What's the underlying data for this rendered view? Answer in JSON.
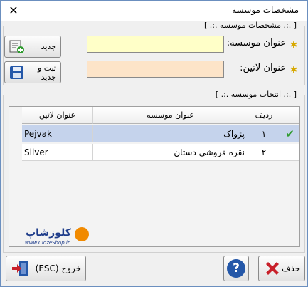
{
  "window": {
    "title": "مشخصات موسسه",
    "close_glyph": "✕"
  },
  "form_group": {
    "caption": "[ .:. مشخصات موسسه .:. ]",
    "fields": [
      {
        "label": "عنوان موسسه:",
        "value": "",
        "bg": "#ffffc8"
      },
      {
        "label": "عنوان لاتین:",
        "value": "",
        "bg": "#fde4c8"
      }
    ],
    "new_button": "جدید",
    "save_new_button": "ثبت و جدید"
  },
  "select_group": {
    "caption": "[ .:. انتخاب موسسه .:. ]",
    "columns": {
      "row": "ردیف",
      "title": "عنوان موسسه",
      "latin": "عنوان لاتین"
    },
    "rows": [
      {
        "num": "۱",
        "title": "پژواک",
        "latin": "Pejvak",
        "selected": true
      },
      {
        "num": "۲",
        "title": "نقره فروشی دستان",
        "latin": "Silver",
        "selected": false
      }
    ]
  },
  "watermark": {
    "name": "کلوزشاپ",
    "url": "www.ClozeShop.ir"
  },
  "footer": {
    "exit_button": "خروج (ESC)",
    "help_glyph": "?",
    "delete_button": "حذف"
  },
  "colors": {
    "selected_row": "#c5d3ec",
    "check": "#2e9b2e",
    "accent_blue": "#2457a8",
    "delete_red": "#c8202a"
  }
}
